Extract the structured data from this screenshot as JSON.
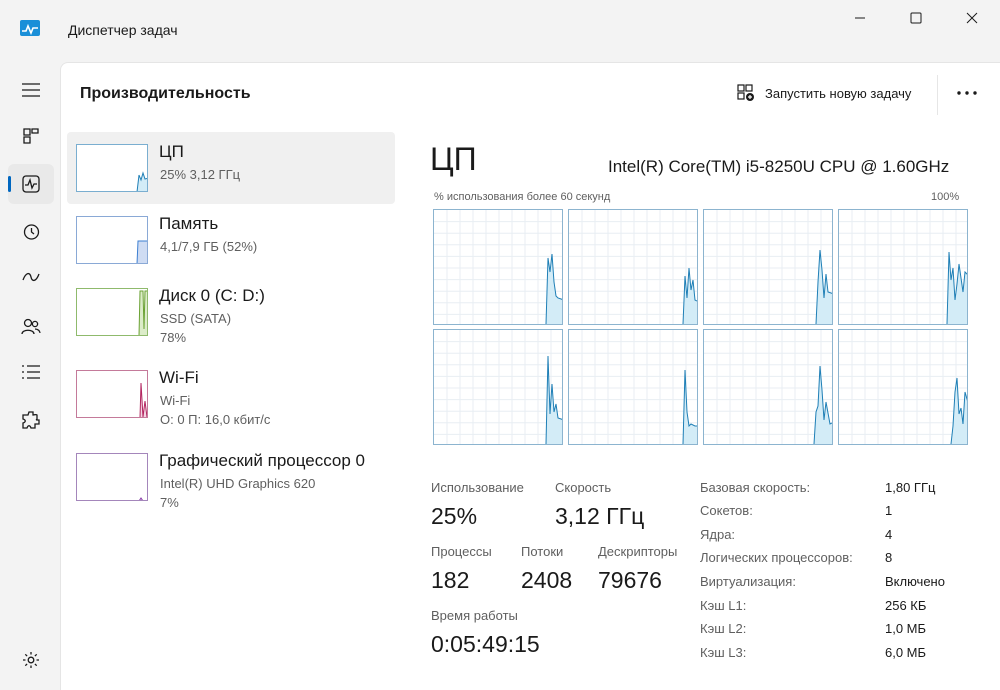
{
  "window": {
    "title": "Диспетчер задач"
  },
  "nav": {
    "items": [
      {
        "icon": "hamburger-icon"
      },
      {
        "icon": "processes-icon"
      },
      {
        "icon": "performance-icon",
        "active": true
      },
      {
        "icon": "app-history-icon"
      },
      {
        "icon": "startup-apps-icon"
      },
      {
        "icon": "users-icon"
      },
      {
        "icon": "details-icon"
      },
      {
        "icon": "services-icon"
      },
      {
        "icon": "settings-icon"
      }
    ]
  },
  "header": {
    "title": "Производительность",
    "run_task_label": "Запустить новую задачу"
  },
  "resources": [
    {
      "name": "ЦП",
      "sub1": "25%  3,12 ГГц",
      "sub2": "",
      "selected": true,
      "color": "#1f7fb6"
    },
    {
      "name": "Память",
      "sub1": "4,1/7,9 ГБ (52%)",
      "sub2": "",
      "color": "#3d7fd1"
    },
    {
      "name": "Диск 0 (C: D:)",
      "sub1": "SSD (SATA)",
      "sub2": "78%",
      "color": "#6ba234"
    },
    {
      "name": "Wi-Fi",
      "sub1": "Wi-Fi",
      "sub2": "О: 0  П: 16,0 кбит/с",
      "color": "#b3245f"
    },
    {
      "name": "Графический процессор 0",
      "sub1": "Intel(R) UHD Graphics 620",
      "sub2": "7%",
      "color": "#8a3fa8"
    }
  ],
  "detail": {
    "title": "ЦП",
    "model": "Intel(R) Core(TM) i5-8250U CPU @ 1.60GHz",
    "graph_label": "% использования более 60 секунд",
    "graph_max": "100%",
    "stats": {
      "usage_label": "Использование",
      "usage_value": "25%",
      "speed_label": "Скорость",
      "speed_value": "3,12 ГГц",
      "processes_label": "Процессы",
      "processes_value": "182",
      "threads_label": "Потоки",
      "threads_value": "2408",
      "handles_label": "Дескрипторы",
      "handles_value": "79676",
      "uptime_label": "Время работы",
      "uptime_value": "0:05:49:15"
    },
    "specs": [
      {
        "label": "Базовая скорость:",
        "value": "1,80 ГГц"
      },
      {
        "label": "Сокетов:",
        "value": "1"
      },
      {
        "label": "Ядра:",
        "value": "4"
      },
      {
        "label": "Логических процессоров:",
        "value": "8"
      },
      {
        "label": "Виртуализация:",
        "value": "Включено"
      },
      {
        "label": "Кэш L1:",
        "value": "256 КБ"
      },
      {
        "label": "Кэш L2:",
        "value": "1,0 МБ"
      },
      {
        "label": "Кэш L3:",
        "value": "6,0 МБ"
      }
    ]
  },
  "colors": {
    "accent": "#0067c0",
    "cpu_line": "#1f7fb6",
    "cpu_fill": "#d3ecf7"
  }
}
